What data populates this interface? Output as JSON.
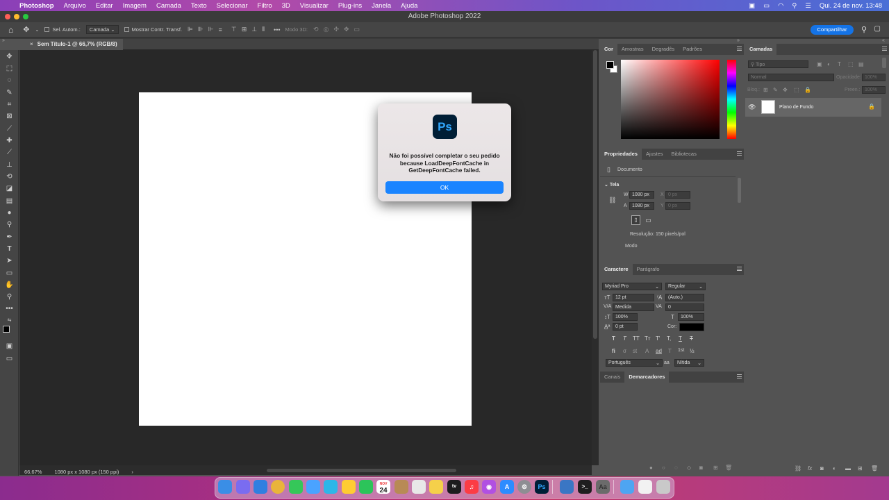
{
  "menubar": {
    "app": "Photoshop",
    "items": [
      "Arquivo",
      "Editar",
      "Imagem",
      "Camada",
      "Texto",
      "Selecionar",
      "Filtro",
      "3D",
      "Visualizar",
      "Plug-ins",
      "Janela",
      "Ajuda"
    ],
    "clock": "Qui. 24 de nov.  13:48"
  },
  "window": {
    "title": "Adobe Photoshop 2022"
  },
  "options_bar": {
    "auto_select_label": "Sel. Autom.:",
    "auto_select_value": "Camada",
    "show_transform_label": "Mostrar Contr. Transf.",
    "mode_3d_label": "Modo 3D:",
    "share_label": "Compartilhar"
  },
  "document": {
    "tab_title": "Sem Título-1 @ 66,7% (RGB/8)",
    "zoom": "66,67%",
    "info": "1080 px x 1080 px (150 ppi)"
  },
  "color_panel": {
    "tabs": [
      "Cor",
      "Amostras",
      "Degradês",
      "Padrões"
    ]
  },
  "properties_panel": {
    "tabs": [
      "Propriedades",
      "Ajustes",
      "Bibliotecas"
    ],
    "type_label": "Documento",
    "section": "Tela",
    "w_label": "W",
    "w_value": "1080 px",
    "h_label": "A",
    "h_value": "1080 px",
    "x_label": "X",
    "x_placeholder": "0 px",
    "y_label": "Y",
    "y_placeholder": "0 px",
    "resolution": "Resolução: 150 pixels/pol",
    "mode_label": "Modo"
  },
  "character_panel": {
    "tabs": [
      "Caractere",
      "Parágrafo"
    ],
    "font_family": "Myriad Pro",
    "font_style": "Regular",
    "size": "12 pt",
    "leading": "(Auto.)",
    "kerning": "Medida",
    "tracking": "0",
    "vscale": "100%",
    "hscale": "100%",
    "baseline": "0 pt",
    "color_label": "Cor:",
    "style_buttons": [
      "T",
      "T",
      "TT",
      "Tт",
      "T'",
      "T,",
      "T",
      "T"
    ],
    "opentype_buttons": [
      "fi",
      "σ",
      "st",
      "A",
      "ad",
      "T",
      "1st",
      "½"
    ],
    "language": "Português",
    "aa_label": "aa",
    "antialias": "Nítida"
  },
  "paths_panel": {
    "tabs": [
      "Canais",
      "Demarcadores"
    ]
  },
  "layers_panel": {
    "title": "Camadas",
    "search_placeholder": "Tipo",
    "blend_mode": "Normal",
    "opacity_label": "Opacidade:",
    "opacity_value": "100%",
    "lock_label": "Bloq.:",
    "fill_label": "Preen.:",
    "fill_value": "100%",
    "layers": [
      {
        "name": "Plano de Fundo"
      }
    ]
  },
  "dialog": {
    "message": "Não foi possível completar o seu pedido because LoadDeepFontCache in GetDeepFontCache failed.",
    "ok_label": "OK"
  },
  "dock": {
    "calendar_month": "NOV",
    "calendar_day": "24",
    "ps_label": "Ps",
    "colors": [
      "#3a8ee6",
      "#7a6cf0",
      "#2f7fe0",
      "#e9b43a",
      "#35c759",
      "#4aa3ff",
      "#2eb6e8",
      "#ffcc33",
      "#2cc45a",
      "#ffffff",
      "#b88a55",
      "#e8e8e8",
      "#f5d04a",
      "#1c1c1e",
      "#fc3c44",
      "#b150e2",
      "#2d8cff",
      "#8e8e93",
      "#001e36",
      "#3a76c4",
      "#1e1e1e",
      "#6b6b6b",
      "#4ea5f2",
      "#f2f2f2",
      "#c9c9c9"
    ]
  }
}
